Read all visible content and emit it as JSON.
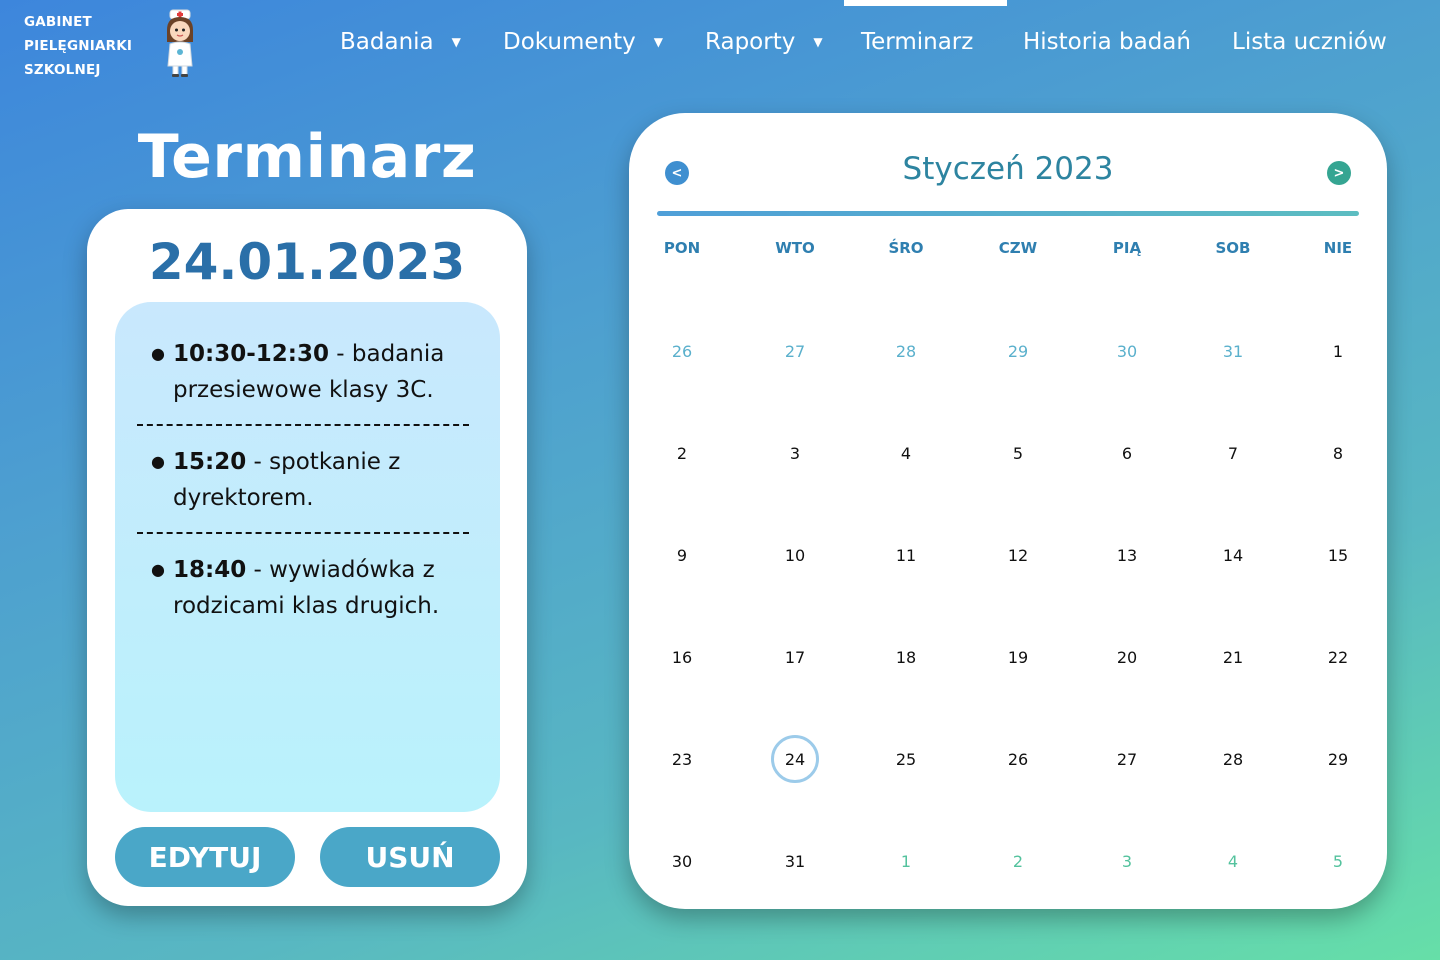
{
  "brand": {
    "line1": "GABINET",
    "line2": "PIELĘGNIARKI",
    "line3": "SZKOLNEJ",
    "logo_icon": "nurse-icon"
  },
  "nav": [
    {
      "label": "Badania",
      "dropdown": true
    },
    {
      "label": "Dokumenty",
      "dropdown": true
    },
    {
      "label": "Raporty",
      "dropdown": true
    },
    {
      "label": "Terminarz",
      "dropdown": false,
      "active": true
    },
    {
      "label": "Historia badań",
      "dropdown": false
    },
    {
      "label": "Lista uczniów",
      "dropdown": false
    }
  ],
  "page_title": "Terminarz",
  "day_panel": {
    "date": "24.01.2023",
    "events": [
      {
        "time": "10:30-12:30",
        "text": " - badania przesiewowe klasy 3C."
      },
      {
        "time": "15:20",
        "text": " - spotkanie z dyrektorem."
      },
      {
        "time": "18:40",
        "text": " - wywiadówka z rodzicami klas drugich."
      }
    ],
    "edit_label": "EDYTUJ",
    "delete_label": "USUŃ"
  },
  "calendar": {
    "title": "Styczeń 2023",
    "prev_icon": "chevron-left-icon",
    "next_icon": "chevron-right-icon",
    "weekdays": [
      "PON",
      "WTO",
      "ŚRO",
      "CZW",
      "PIĄ",
      "SOB",
      "NIE"
    ],
    "weeks": [
      [
        "26",
        "27",
        "28",
        "29",
        "30",
        "31",
        "1"
      ],
      [
        "2",
        "3",
        "4",
        "5",
        "6",
        "7",
        "8"
      ],
      [
        "9",
        "10",
        "11",
        "12",
        "13",
        "14",
        "15"
      ],
      [
        "16",
        "17",
        "18",
        "19",
        "20",
        "21",
        "22"
      ],
      [
        "23",
        "24",
        "25",
        "26",
        "27",
        "28",
        "29"
      ],
      [
        "30",
        "31",
        "1",
        "2",
        "3",
        "4",
        "5"
      ]
    ],
    "selected_day": "24",
    "colors": {
      "accent": "#2d84a0",
      "selected_ring": "#9ccbea",
      "prev_month": "#5ab0cc",
      "next_month": "#53c29d"
    }
  }
}
